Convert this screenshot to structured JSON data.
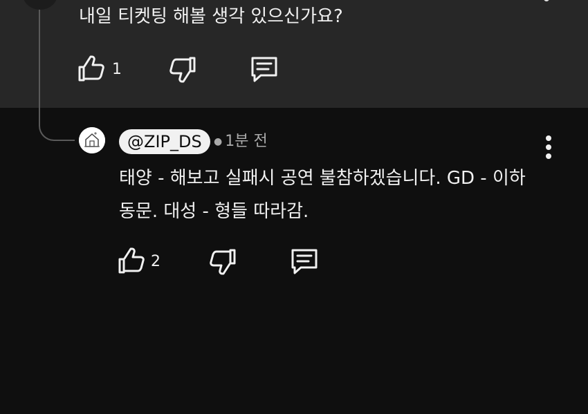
{
  "previous_comment": {
    "text": "내일 티켓팅 해볼 생각 있으신가요?",
    "like_count": "1"
  },
  "reply": {
    "handle": "@ZIP_DS",
    "time_ago": "1분 전",
    "text": "태양 - 해보고 실패시 공연 불참하겠습니다. GD - 이하동문. 대성 - 형들 따라감.",
    "like_count": "2"
  },
  "icons": {
    "like": "thumbs-up-icon",
    "dislike": "thumbs-down-icon",
    "reply": "comment-icon",
    "menu": "more-vertical-icon"
  },
  "colors": {
    "page_background": "#0f0f0f",
    "previous_comment_background": "#272727",
    "text": "#f1f1f1",
    "meta_text": "#aaaaaa"
  }
}
